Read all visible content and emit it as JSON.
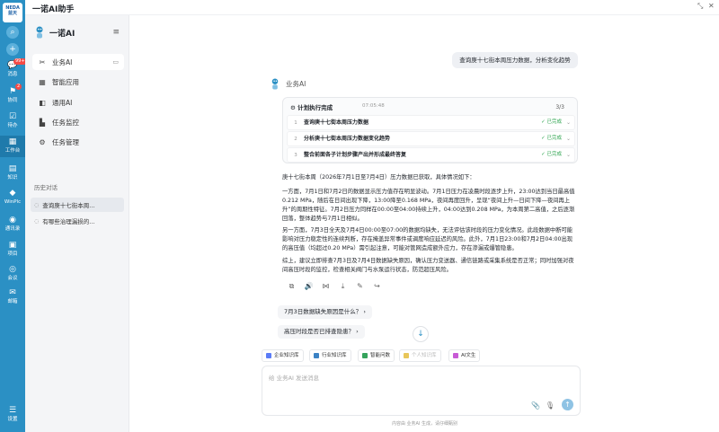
{
  "app": {
    "title": "一诺AI助手"
  },
  "rail": {
    "logo": "NEDA 蓝天",
    "items": [
      {
        "label": "消息",
        "icon": "chat-icon",
        "badge": "99+"
      },
      {
        "label": "协同",
        "icon": "people-icon",
        "badge": "2"
      },
      {
        "label": "待办",
        "icon": "todo-icon",
        "badge": ""
      },
      {
        "label": "工作台",
        "icon": "workbench-icon",
        "badge": ""
      },
      {
        "label": "知识",
        "icon": "book-icon",
        "badge": ""
      },
      {
        "label": "WinPlc",
        "icon": "plc-icon",
        "badge": ""
      },
      {
        "label": "通讯录",
        "icon": "contacts-icon",
        "badge": ""
      },
      {
        "label": "项目",
        "icon": "folder-icon",
        "badge": ""
      },
      {
        "label": "会议",
        "icon": "meeting-icon",
        "badge": ""
      },
      {
        "label": "邮箱",
        "icon": "mail-icon",
        "badge": ""
      },
      {
        "label": "设置",
        "icon": "menu-icon",
        "badge": ""
      }
    ]
  },
  "sidebar": {
    "brand": "一诺AI",
    "nav": [
      {
        "label": "业务AI",
        "icon": "tools-icon"
      },
      {
        "label": "智能应用",
        "icon": "grid-icon"
      },
      {
        "label": "通用AI",
        "icon": "chip-icon"
      },
      {
        "label": "任务监控",
        "icon": "monitor-icon"
      },
      {
        "label": "任务管理",
        "icon": "gear-icon"
      }
    ],
    "history_title": "历史对话",
    "history": [
      "查询庚十七街本周...",
      "有哪些治理漏损的..."
    ]
  },
  "chat": {
    "user_message": "查询庚十七街本周压力数据，分析变化趋势",
    "ai_name": "业务AI",
    "plan": {
      "title": "计划执行完成",
      "time": "07:05:48",
      "count": "3/3",
      "steps": [
        {
          "num": "1",
          "label": "查询庚十七街本周压力数据",
          "status": "已完成"
        },
        {
          "num": "2",
          "label": "分析庚十七街本周压力数据变化趋势",
          "status": "已完成"
        },
        {
          "num": "3",
          "label": "整合前面各子计划步骤产出并形成最终答复",
          "status": "已完成"
        }
      ]
    },
    "response": [
      "庚十七街本周（2026年7月1日至7月4日）压力数据已获取，具体情况如下：",
      "一方面，7月1日和7月2日的数据显示压力值存在明显波动。7月1日压力在凌晨时段逐步上升，23:00达到当日最高值0.212 MPa，随后在日间出现下降，13:00降至0.168 MPa，夜间再度回升，呈现“夜间上升—日间下降—夜间再上升”的周期性特征。7月2日压力同样在00:00至04:00持续上升，04:00达到0.208 MPa，为本周第二高值，之后逐渐回落，整体趋势与7月1日相似。",
      "另一方面，7月3日全天及7月4日00:00至07:00的数据均缺失，无法评估该时段的压力变化情况。此段数据中断可能影响对压力稳定性的连续判断，存在掩盖异常事件或调度响应延迟的风险。此外，7月1日23:00和7月2日04:00出现的高压值（均超过0.20 MPa）需引起注意，可能对管网造成额外应力，存在渗漏或爆管隐患。",
      "综上，建议立即排查7月3日及7月4日数据缺失原因，确认压力变送器、通信链路或采集系统是否正常；同时加强对夜间高压时段的监控，检查相关阀门与水泵运行状态，防范超压风险。"
    ],
    "suggestions": [
      "7月3日数据缺失原因是什么？",
      "高压时段是否已排查隐患？"
    ]
  },
  "input": {
    "placeholder": "给 业务AI 发送消息",
    "chips": [
      {
        "label": "企业知识库",
        "color": "#5b7cf7"
      },
      {
        "label": "行业知识库",
        "color": "#3b82c4"
      },
      {
        "label": "智能问数",
        "color": "#35a35c"
      },
      {
        "label": "个人知识库",
        "color": "#e8c65a"
      },
      {
        "label": "AI文生",
        "color": "#c85bd6"
      }
    ],
    "disclaimer": "内容由 业务AI 生成，请仔细甄别"
  }
}
